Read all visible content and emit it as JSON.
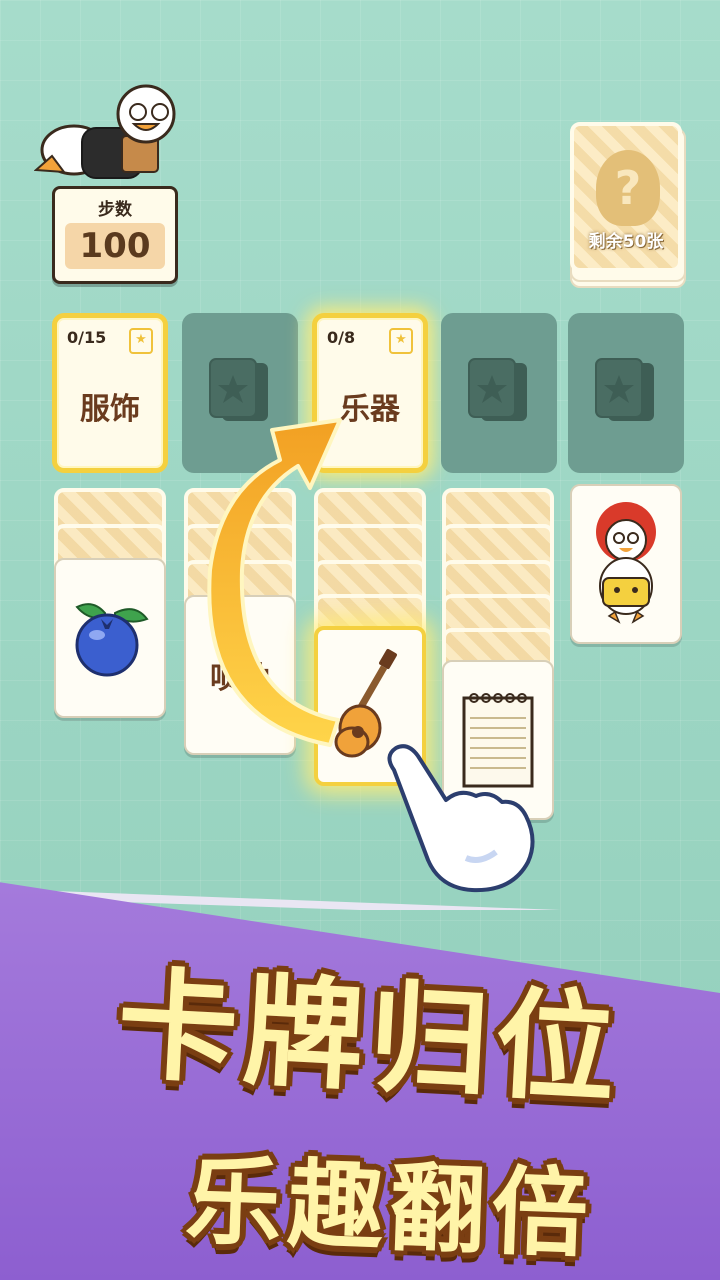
{
  "steps": {
    "label": "步数",
    "value": "100"
  },
  "deck": {
    "icon": "?",
    "label": "剩余50张"
  },
  "slots": [
    {
      "count": "0/15",
      "title": "服饰",
      "state": "filled"
    },
    {
      "state": "empty"
    },
    {
      "count": "0/8",
      "title": "乐器",
      "state": "filled"
    },
    {
      "state": "empty"
    },
    {
      "state": "empty"
    }
  ],
  "cards": {
    "col1_face": "blueberry",
    "col2_face_text": "唢呐",
    "col3_face": "guitar",
    "col4_face": "notebook",
    "col5_face": "clown-duck"
  },
  "banner": {
    "line1": "卡牌归位",
    "line2": "乐趣翻倍"
  },
  "colors": {
    "accent": "#f4d03f",
    "banner": "#9a6ed8",
    "text_brown": "#6a3b1e"
  }
}
